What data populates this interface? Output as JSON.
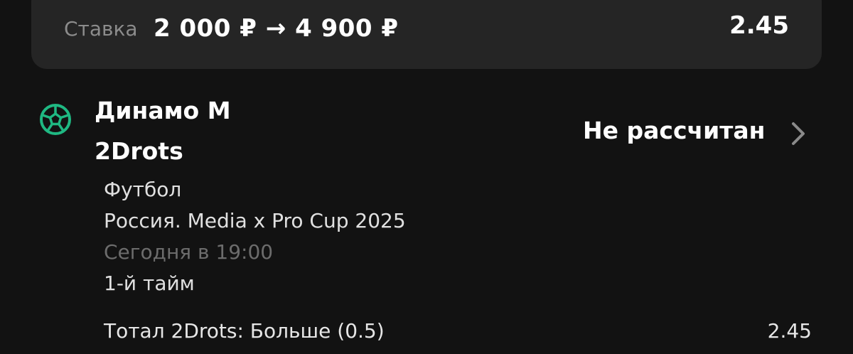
{
  "stake": {
    "label": "Ставка",
    "amount": "2 000 ₽ → 4 900 ₽",
    "coefficient": "2.45"
  },
  "event": {
    "sport_icon": "football-icon",
    "team_1": "Динамо М",
    "team_2": "2Drots",
    "status": "Не рассчитан",
    "sport": "Футбол",
    "league": "Россия. Media x Pro Cup 2025",
    "time": "Сегодня в 19:00",
    "period": "1-й тайм"
  },
  "market": {
    "name": "Тотал 2Drots: Больше (0.5)",
    "coefficient": "2.45"
  },
  "colors": {
    "background": "#121212",
    "card": "#252525",
    "accent_green": "#1fb882",
    "muted_text": "#8c8c8c"
  }
}
